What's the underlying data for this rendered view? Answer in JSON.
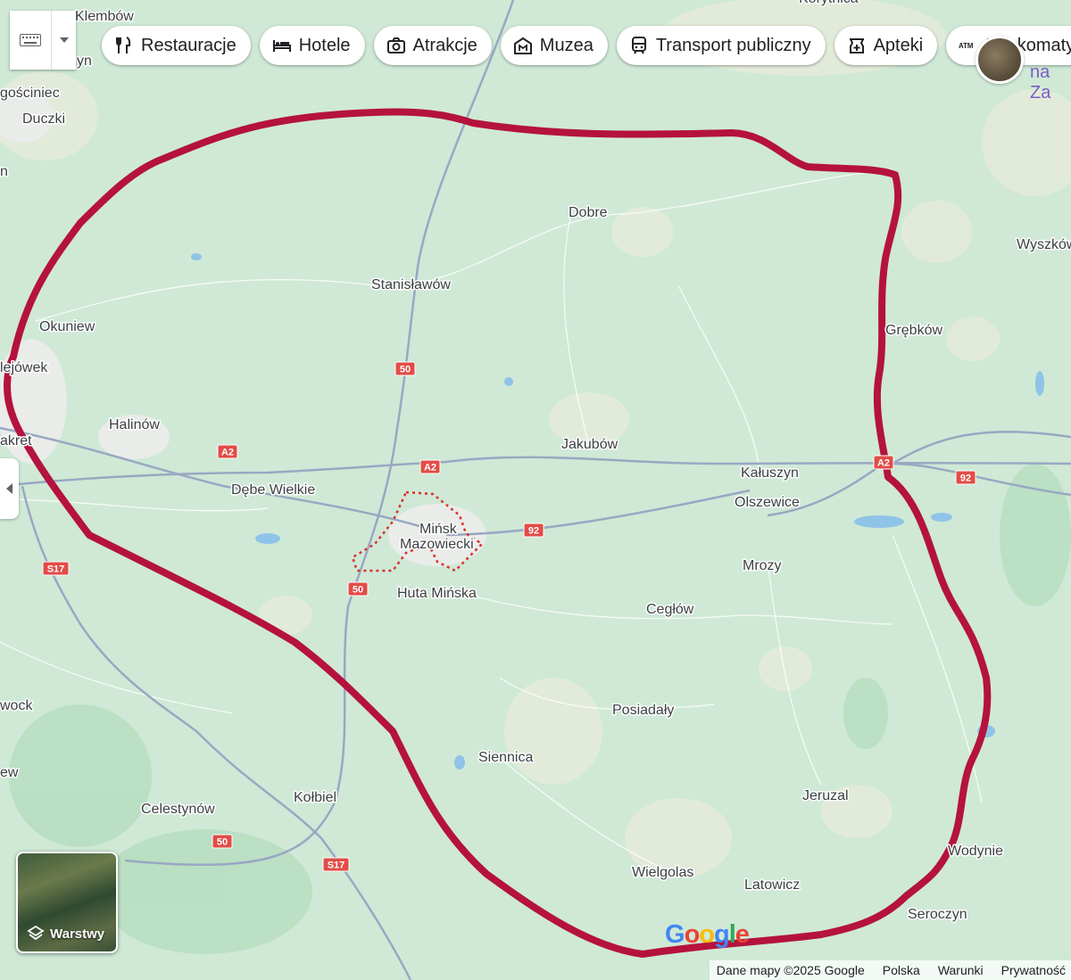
{
  "toolbar": {
    "chips": [
      {
        "label": "Restauracje",
        "icon": "fork-knife-icon"
      },
      {
        "label": "Hotele",
        "icon": "bed-icon"
      },
      {
        "label": "Atrakcje",
        "icon": "camera-icon"
      },
      {
        "label": "Muzea",
        "icon": "museum-icon"
      },
      {
        "label": "Transport publiczny",
        "icon": "train-icon"
      },
      {
        "label": "Apteki",
        "icon": "pharmacy-icon"
      },
      {
        "label": "Bankomaty",
        "icon": "atm-icon"
      }
    ]
  },
  "corner_link": "na Za",
  "layers": {
    "label": "Warstwy"
  },
  "google_logo": "Google",
  "footer": {
    "map_data": "Dane mapy ©2025 Google",
    "country": "Polska",
    "terms": "Warunki",
    "privacy": "Prywatność"
  },
  "map": {
    "places": [
      {
        "name": "Klembów"
      },
      {
        "name": "gościniec"
      },
      {
        "name": "Duczki"
      },
      {
        "name": "Dobre"
      },
      {
        "name": "Stanisławów"
      },
      {
        "name": "Okuniew"
      },
      {
        "name": "Wyszków"
      },
      {
        "name": "Grębków"
      },
      {
        "name": "Halinów"
      },
      {
        "name": "Jakubów"
      },
      {
        "name": "Kałuszyn"
      },
      {
        "name": "Olszewice"
      },
      {
        "name": "Dębe Wielkie"
      },
      {
        "name": "Mińsk"
      },
      {
        "name": "Mazowiecki"
      },
      {
        "name": "Huta Mińska"
      },
      {
        "name": "Mrozy"
      },
      {
        "name": "Cegłów"
      },
      {
        "name": "Posiadały"
      },
      {
        "name": "Siennica"
      },
      {
        "name": "Kołbiel"
      },
      {
        "name": "Celestynów"
      },
      {
        "name": "Jeruzal"
      },
      {
        "name": "Wodynie"
      },
      {
        "name": "Wielgolas"
      },
      {
        "name": "Latowicz"
      },
      {
        "name": "Seroczyn"
      },
      {
        "name": "lejówek"
      },
      {
        "name": "akret"
      },
      {
        "name": "wock"
      },
      {
        "name": "ew"
      },
      {
        "name": "yn"
      },
      {
        "name": "n"
      },
      {
        "name": "Korytnica"
      }
    ],
    "road_shields": [
      {
        "label": "50"
      },
      {
        "label": "50"
      },
      {
        "label": "50"
      },
      {
        "label": "A2"
      },
      {
        "label": "A2"
      },
      {
        "label": "A2"
      },
      {
        "label": "92"
      },
      {
        "label": "92"
      },
      {
        "label": "S17"
      },
      {
        "label": "S17"
      }
    ],
    "colors": {
      "boundary": "#b5123e",
      "town_outline": "#d9302b",
      "land": "#cfe9d6",
      "road_shield": "#e24c47"
    }
  }
}
